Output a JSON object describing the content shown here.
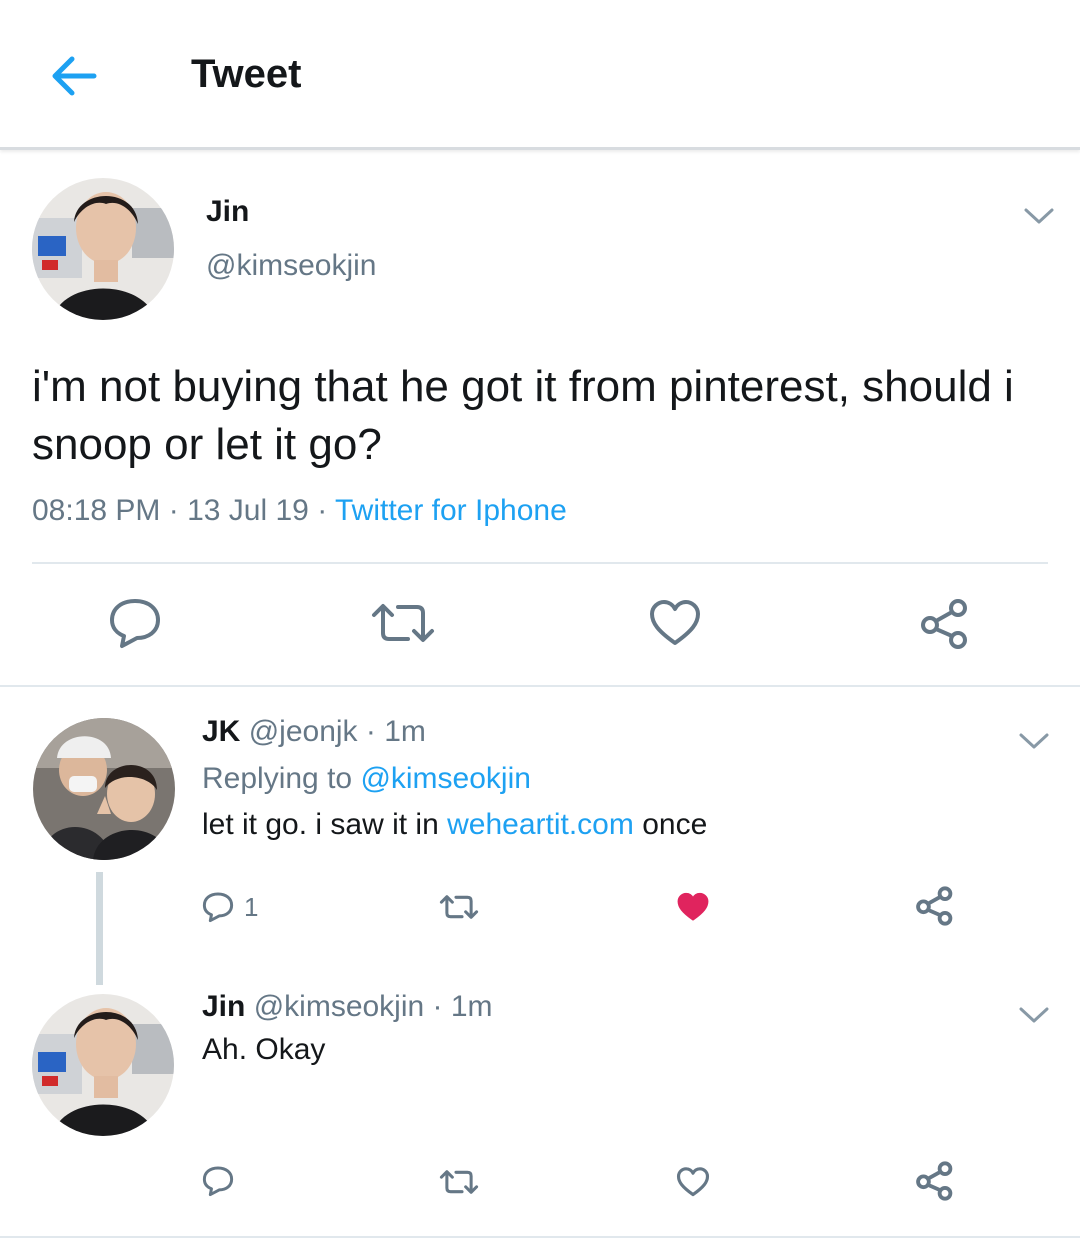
{
  "header": {
    "title": "Tweet"
  },
  "main_tweet": {
    "name": "Jin",
    "handle": "@kimseokjin",
    "text": "i'm not buying that he got it from pinterest, should i snoop or let it go?",
    "time": "08:18 PM",
    "date": "13 Jul 19",
    "source": "Twitter for Iphone",
    "separator": " · "
  },
  "replies": [
    {
      "name": "JK",
      "handle": "@jeonjk",
      "time_prefix": " · ",
      "time": "1m",
      "replying_prefix": "Replying to ",
      "replying_to": "@kimseokjin",
      "text_before": "let it go. i saw it in ",
      "text_link": "weheartit.com",
      "text_after": " once",
      "reply_count": "1",
      "liked": true
    },
    {
      "name": "Jin",
      "handle": "@kimseokjin",
      "time_prefix": " · ",
      "time": "1m",
      "text": "Ah. Okay",
      "liked": false
    }
  ],
  "colors": {
    "accent": "#1da1f2",
    "like_active": "#e0245e",
    "secondary_text": "#657786",
    "icon": "#657786"
  },
  "icons": [
    "back-arrow-icon",
    "chevron-down-icon",
    "reply-icon",
    "retweet-icon",
    "heart-icon",
    "share-icon"
  ]
}
